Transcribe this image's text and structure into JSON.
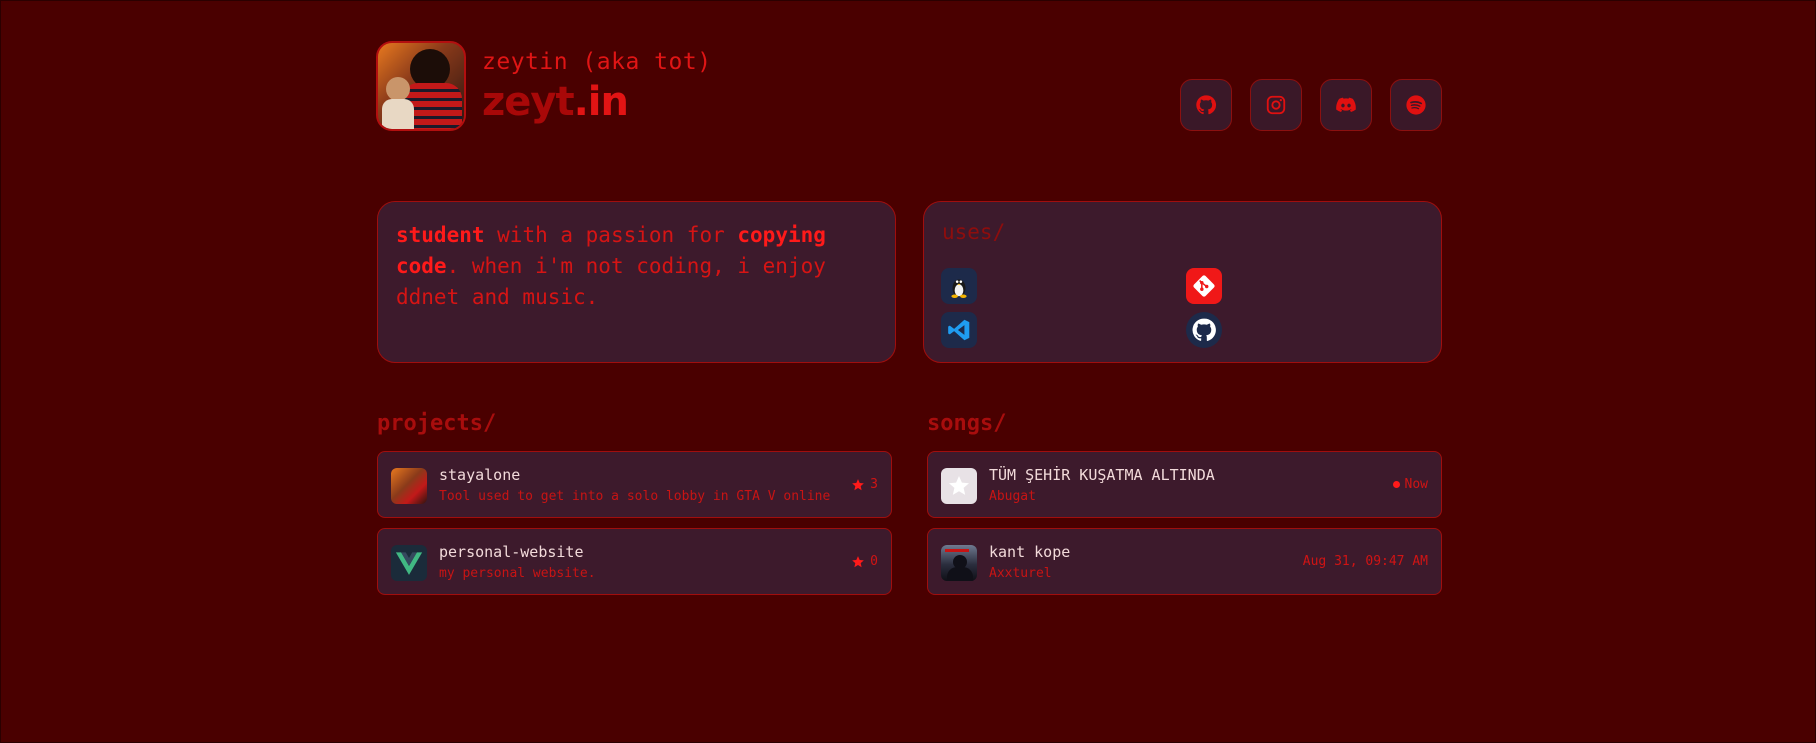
{
  "profile": {
    "subname": "zeytin (aka tot)",
    "domain_main": "zeyt",
    "domain_tld": ".in"
  },
  "socials": [
    {
      "icon": "github-icon"
    },
    {
      "icon": "instagram-icon"
    },
    {
      "icon": "discord-icon"
    },
    {
      "icon": "spotify-icon"
    }
  ],
  "bio": {
    "strong1": "student",
    "text1": " with a passion for ",
    "strong2": "copying code",
    "text2": ". when i'm not coding, i enjoy ddnet and music."
  },
  "uses": {
    "title": "uses/",
    "tools": [
      "linux-icon",
      "git-icon",
      "vscode-icon",
      "github-icon"
    ]
  },
  "projects": {
    "title": "projects/",
    "items": [
      {
        "name": "stayalone",
        "description": "Tool used to get into a solo lobby in GTA V online",
        "stars": "3"
      },
      {
        "name": "personal-website",
        "description": "my personal website.",
        "stars": "0"
      }
    ]
  },
  "songs": {
    "title": "songs/",
    "items": [
      {
        "title": "TÜM ŞEHİR KUŞATMA ALTINDA",
        "artist": "Abugat",
        "when": "Now"
      },
      {
        "title": "kant kope",
        "artist": "Axxturel",
        "when": "Aug 31, 09:47 AM"
      }
    ]
  },
  "colors": {
    "background": "#4a0000",
    "card": "#3d1a2c",
    "accent": "#e01010",
    "border": "#a00e0e"
  }
}
